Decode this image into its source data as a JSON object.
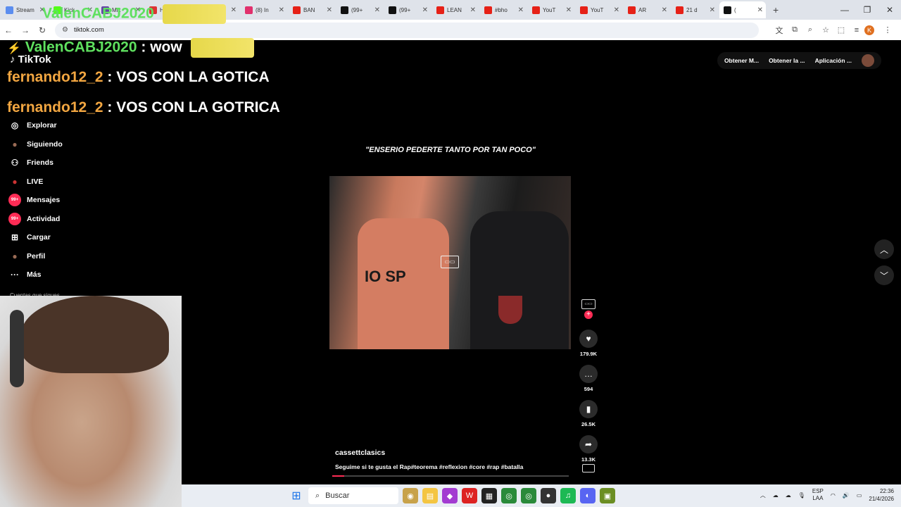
{
  "browser": {
    "tabs": [
      {
        "label": "Stream",
        "color": "#5b8def"
      },
      {
        "label": "Kick",
        "color": "#53fc18"
      },
      {
        "label": "Mix",
        "color": "#6441a5"
      },
      {
        "label": "Ham",
        "color": "#d33"
      },
      {
        "label": "(99+",
        "color": "#111"
      },
      {
        "label": "(8) In",
        "color": "#e1306c"
      },
      {
        "label": "BAN",
        "color": "#e62117"
      },
      {
        "label": "(99+",
        "color": "#111"
      },
      {
        "label": "(99+",
        "color": "#111"
      },
      {
        "label": "LEAN",
        "color": "#e62117"
      },
      {
        "label": "#bho",
        "color": "#e62117"
      },
      {
        "label": "YouT",
        "color": "#e62117"
      },
      {
        "label": "YouT",
        "color": "#e62117"
      },
      {
        "label": "AR",
        "color": "#e62117"
      },
      {
        "label": "21 d",
        "color": "#e62117"
      },
      {
        "label": "(",
        "color": "#111",
        "active": true
      }
    ],
    "url": "tiktok.com"
  },
  "overlay": {
    "chat": [
      {
        "user": "ValenCABJ2020",
        "message": "",
        "color": "green"
      },
      {
        "user": "ValenCABJ2020",
        "message": ": wow",
        "color": "green"
      },
      {
        "user": "fernando12_2",
        "message": ": VOS CON LA GOTICA",
        "color": "orange"
      },
      {
        "user": "fernando12_2",
        "message": ": VOS CON LA GOTRICA",
        "color": "orange"
      }
    ]
  },
  "tiktok": {
    "logo": "TikTok",
    "sidebar": [
      {
        "label": "Explorar",
        "icon": "compass-icon"
      },
      {
        "label": "Siguiendo",
        "icon": "following-avatar-icon"
      },
      {
        "label": "Friends",
        "icon": "friends-icon"
      },
      {
        "label": "LIVE",
        "icon": "live-icon"
      },
      {
        "label": "Mensajes",
        "icon": "messages-icon",
        "badge": "99+"
      },
      {
        "label": "Actividad",
        "icon": "activity-icon",
        "badge": "99+"
      },
      {
        "label": "Cargar",
        "icon": "upload-icon"
      },
      {
        "label": "Perfil",
        "icon": "profile-icon"
      },
      {
        "label": "Más",
        "icon": "more-icon"
      }
    ],
    "following_label": "Cuentas que sigues",
    "top_actions": [
      "Obtener M...",
      "Obtener la ...",
      "Aplicación ..."
    ],
    "video": {
      "caption_overlay": "\"ENSERIO PEDERTE TANTO POR TAN POCO\"",
      "shirt_text": "IO SP",
      "author": "cassettclasics",
      "description": "Seguime si te gusta el Rap#teorema #reflexion #core #rap #batalla",
      "likes": "179.9K",
      "comments": "594",
      "saves": "26.5K",
      "shares": "13.3K",
      "progress": 0.05
    }
  },
  "taskbar": {
    "search_placeholder": "Buscar",
    "lang": "ESP",
    "lang2": "LAA",
    "time": "22:36",
    "date": "21/4/2026"
  }
}
